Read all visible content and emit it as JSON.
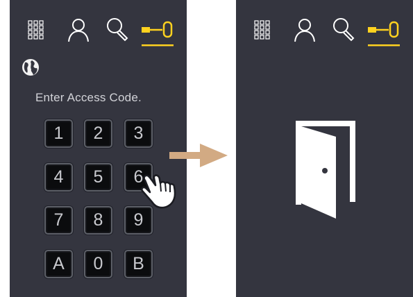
{
  "colors": {
    "panel": "#34353f",
    "accent": "#ffd21f",
    "icon": "#ffffff",
    "arrow": "#d2aa83",
    "key_bg": "#0b0c0e"
  },
  "left_screen": {
    "icons": [
      "keypad-icon",
      "user-icon",
      "search-icon",
      "key-icon"
    ],
    "language_icon": "globe-icon",
    "prompt": "Enter Access Code.",
    "keys": [
      "1",
      "2",
      "3",
      "4",
      "5",
      "6",
      "7",
      "8",
      "9",
      "A",
      "0",
      "B"
    ]
  },
  "transition_icon": "arrow-right-icon",
  "pointer_icon": "hand-pointer-icon",
  "right_screen": {
    "icons": [
      "keypad-icon",
      "user-icon",
      "search-icon",
      "key-icon"
    ],
    "status_icon": "door-open-icon"
  }
}
